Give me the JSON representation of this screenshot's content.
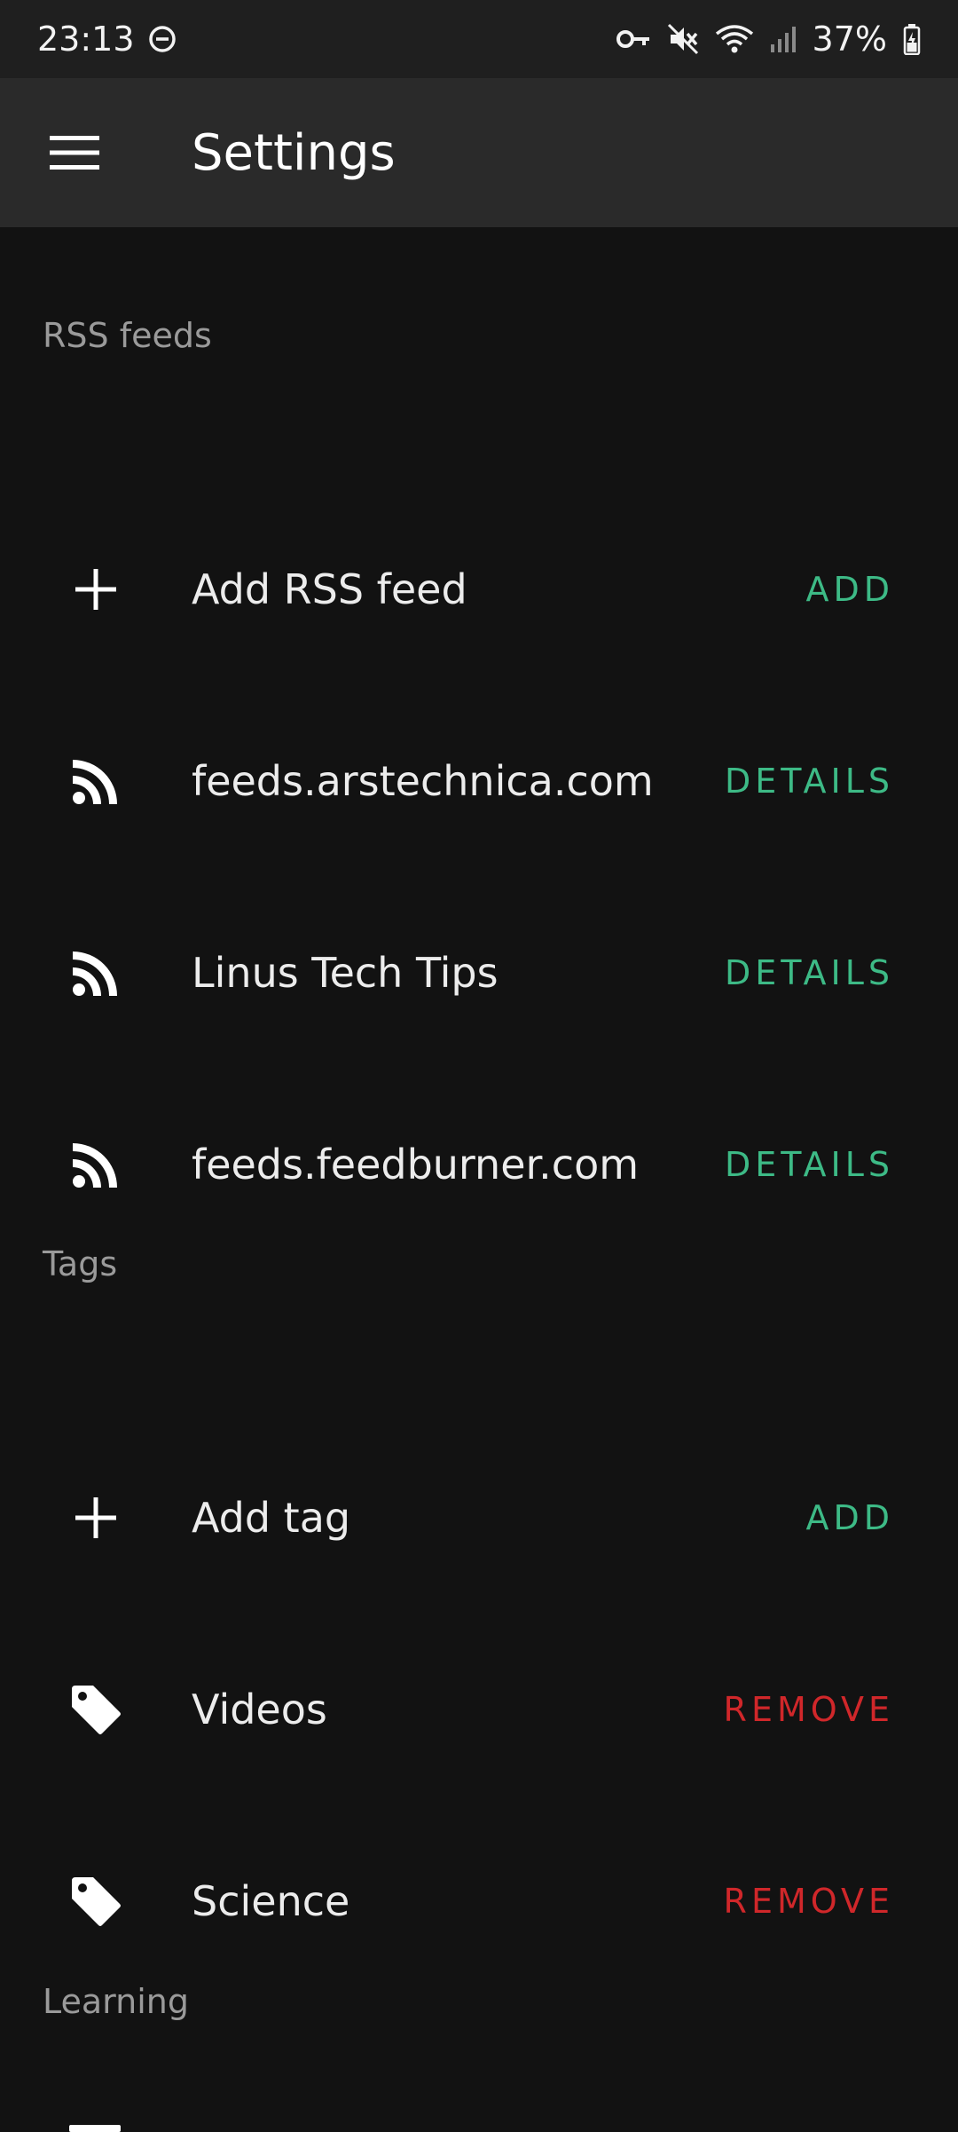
{
  "status_bar": {
    "time": "23:13",
    "battery": "37%",
    "icons": [
      "do-not-disturb-icon",
      "vpn-key-icon",
      "mute-icon",
      "wifi-icon",
      "signal-icon",
      "battery-icon"
    ]
  },
  "app_bar": {
    "title": "Settings",
    "menu_icon": "menu-icon"
  },
  "sections": {
    "rss": {
      "header": "RSS feeds",
      "add": {
        "label": "Add RSS feed",
        "action": "ADD",
        "icon": "plus-icon"
      },
      "feeds": [
        {
          "label": "feeds.arstechnica.com",
          "action": "DETAILS",
          "icon": "rss-icon"
        },
        {
          "label": "Linus Tech Tips",
          "action": "DETAILS",
          "icon": "rss-icon"
        },
        {
          "label": "feeds.feedburner.com",
          "action": "DETAILS",
          "icon": "rss-icon"
        }
      ]
    },
    "tags": {
      "header": "Tags",
      "add": {
        "label": "Add tag",
        "action": "ADD",
        "icon": "plus-icon"
      },
      "items": [
        {
          "label": "Videos",
          "action": "REMOVE",
          "icon": "tag-icon"
        },
        {
          "label": "Science",
          "action": "REMOVE",
          "icon": "tag-icon"
        }
      ]
    },
    "learning": {
      "header": "Learning"
    }
  },
  "colors": {
    "accent_green": "#3dba86",
    "destructive_red": "#d0272a",
    "background": "#121212",
    "app_bar": "#2a2a2a"
  }
}
